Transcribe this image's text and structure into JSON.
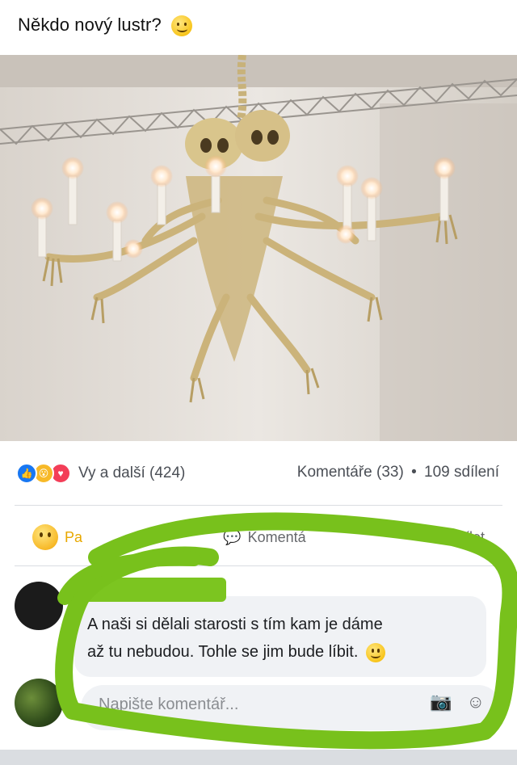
{
  "post": {
    "text": "Někdo nový lustr?",
    "emoji_icon": "smiley-icon"
  },
  "photo": {
    "icon": "skeleton-chandelier-image"
  },
  "reactions": {
    "icons": [
      "like-icon",
      "wow-icon",
      "love-icon"
    ],
    "label": "Vy a další (424)"
  },
  "stats": {
    "comments": "Komentáře (33)",
    "separator": "•",
    "shares": "109 sdílení"
  },
  "actions": {
    "react_label": "Pa",
    "comment_label": "Komentá",
    "share_label": "ílet"
  },
  "comment": {
    "text_line1": "A naši si dělali starosti s tím kam je dáme",
    "text_line2": "až tu nebudou. Tohle se jim bude líbit."
  },
  "composer": {
    "placeholder": "Napište komentář..."
  },
  "colors": {
    "scribble": "#78c11c",
    "like": "#1877f2",
    "wow": "#f7b928",
    "love": "#f33e58"
  }
}
